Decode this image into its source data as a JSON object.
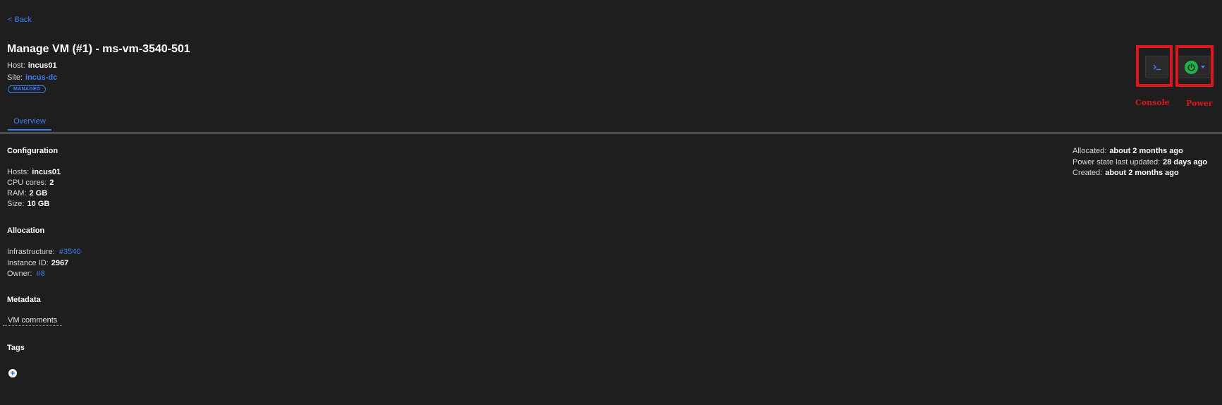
{
  "nav": {
    "back_label": "< Back"
  },
  "header": {
    "title": "Manage VM (#1) - ms-vm-3540-501",
    "host_label": "Host:",
    "host_value": "incus01",
    "site_label": "Site:",
    "site_value": "incus-dc",
    "badge": "MANAGED"
  },
  "tabs": [
    {
      "label": "Overview",
      "active": true
    }
  ],
  "configuration": {
    "heading": "Configuration",
    "hosts_label": "Hosts:",
    "hosts_value": "incus01",
    "cpu_label": "CPU cores:",
    "cpu_value": "2",
    "ram_label": "RAM:",
    "ram_value": "2 GB",
    "size_label": "Size:",
    "size_value": "10 GB"
  },
  "allocation": {
    "heading": "Allocation",
    "infra_label": "Infrastructure:",
    "infra_value": "#3540",
    "instance_label": "Instance ID:",
    "instance_value": "2967",
    "owner_label": "Owner:",
    "owner_value": "#8"
  },
  "metadata": {
    "heading": "Metadata",
    "vm_comments": "VM comments"
  },
  "tags": {
    "heading": "Tags",
    "add_icon": "plus-circle-icon"
  },
  "meta_right": {
    "allocated_label": "Allocated:",
    "allocated_value": "about 2 months ago",
    "power_label": "Power state last updated:",
    "power_value": "28 days ago",
    "created_label": "Created:",
    "created_value": "about 2 months ago"
  },
  "actions": {
    "console_icon": "terminal-icon",
    "power_icon": "power-icon",
    "console_annotation": "Console",
    "power_annotation": "Power"
  },
  "colors": {
    "background": "#1e1e1e",
    "accent": "#3d7ff5",
    "power_on": "#22b14c",
    "annotation": "#e3141b"
  }
}
